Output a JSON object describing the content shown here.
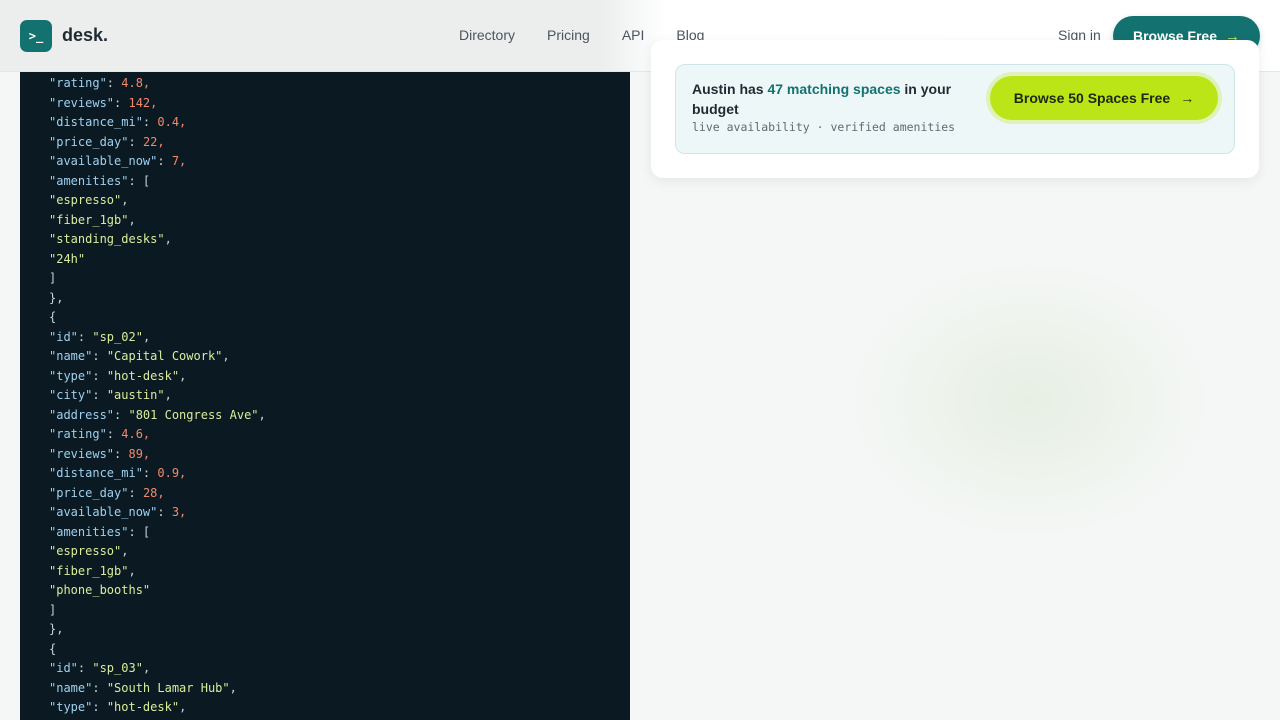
{
  "nav": {
    "logo_glyph": ">_",
    "brand": "desk.",
    "links": [
      "Directory",
      "Pricing",
      "API",
      "Blog"
    ],
    "signin": "Sign in",
    "cta": "Browse Free",
    "cta_arrow": "→"
  },
  "card": {
    "headline_pre": "Austin has ",
    "headline_highlight": "47 matching spaces",
    "headline_post": " in your budget",
    "subline": "live availability · verified amenities",
    "button": "Browse 50 Spaces Free",
    "button_arrow": "→"
  },
  "code": {
    "lines": [
      [
        [
          "key",
          "\"rating\""
        ],
        [
          "punc",
          ": "
        ],
        [
          "num",
          "4.8,"
        ]
      ],
      [
        [
          "key",
          "\"reviews\""
        ],
        [
          "punc",
          ": "
        ],
        [
          "num",
          "142,"
        ]
      ],
      [
        [
          "key",
          "\"distance_mi\""
        ],
        [
          "punc",
          ": "
        ],
        [
          "num",
          "0.4,"
        ]
      ],
      [
        [
          "key",
          "\"price_day\""
        ],
        [
          "punc",
          ": "
        ],
        [
          "num",
          "22,"
        ]
      ],
      [
        [
          "key",
          "\"available_now\""
        ],
        [
          "punc",
          ": "
        ],
        [
          "num",
          "7,"
        ]
      ],
      [
        [
          "key",
          "\"amenities\""
        ],
        [
          "punc",
          ": ["
        ]
      ],
      [
        [
          "str",
          "\"espresso\""
        ],
        [
          "punc",
          ","
        ]
      ],
      [
        [
          "str",
          "\"fiber_1gb\""
        ],
        [
          "punc",
          ","
        ]
      ],
      [
        [
          "str",
          "\"standing_desks\""
        ],
        [
          "punc",
          ","
        ]
      ],
      [
        [
          "str",
          "\"24h\""
        ]
      ],
      [
        [
          "punc",
          "]"
        ]
      ],
      [
        [
          "punc",
          "},"
        ]
      ],
      [
        [
          "punc",
          "{"
        ]
      ],
      [
        [
          "key",
          "\"id\""
        ],
        [
          "punc",
          ": "
        ],
        [
          "str",
          "\"sp_02\""
        ],
        [
          "punc",
          ","
        ]
      ],
      [
        [
          "key",
          "\"name\""
        ],
        [
          "punc",
          ": "
        ],
        [
          "str",
          "\"Capital Cowork\""
        ],
        [
          "punc",
          ","
        ]
      ],
      [
        [
          "key",
          "\"type\""
        ],
        [
          "punc",
          ": "
        ],
        [
          "str",
          "\"hot-desk\""
        ],
        [
          "punc",
          ","
        ]
      ],
      [
        [
          "key",
          "\"city\""
        ],
        [
          "punc",
          ": "
        ],
        [
          "str",
          "\"austin\""
        ],
        [
          "punc",
          ","
        ]
      ],
      [
        [
          "key",
          "\"address\""
        ],
        [
          "punc",
          ": "
        ],
        [
          "str",
          "\"801 Congress Ave\""
        ],
        [
          "punc",
          ","
        ]
      ],
      [
        [
          "key",
          "\"rating\""
        ],
        [
          "punc",
          ": "
        ],
        [
          "num",
          "4.6,"
        ]
      ],
      [
        [
          "key",
          "\"reviews\""
        ],
        [
          "punc",
          ": "
        ],
        [
          "num",
          "89,"
        ]
      ],
      [
        [
          "key",
          "\"distance_mi\""
        ],
        [
          "punc",
          ": "
        ],
        [
          "num",
          "0.9,"
        ]
      ],
      [
        [
          "key",
          "\"price_day\""
        ],
        [
          "punc",
          ": "
        ],
        [
          "num",
          "28,"
        ]
      ],
      [
        [
          "key",
          "\"available_now\""
        ],
        [
          "punc",
          ": "
        ],
        [
          "num",
          "3,"
        ]
      ],
      [
        [
          "key",
          "\"amenities\""
        ],
        [
          "punc",
          ": ["
        ]
      ],
      [
        [
          "str",
          "\"espresso\""
        ],
        [
          "punc",
          ","
        ]
      ],
      [
        [
          "str",
          "\"fiber_1gb\""
        ],
        [
          "punc",
          ","
        ]
      ],
      [
        [
          "str",
          "\"phone_booths\""
        ]
      ],
      [
        [
          "punc",
          "]"
        ]
      ],
      [
        [
          "punc",
          "},"
        ]
      ],
      [
        [
          "punc",
          "{"
        ]
      ],
      [
        [
          "key",
          "\"id\""
        ],
        [
          "punc",
          ": "
        ],
        [
          "str",
          "\"sp_03\""
        ],
        [
          "punc",
          ","
        ]
      ],
      [
        [
          "key",
          "\"name\""
        ],
        [
          "punc",
          ": "
        ],
        [
          "str",
          "\"South Lamar Hub\""
        ],
        [
          "punc",
          ","
        ]
      ],
      [
        [
          "key",
          "\"type\""
        ],
        [
          "punc",
          ": "
        ],
        [
          "str",
          "\"hot-desk\""
        ],
        [
          "punc",
          ","
        ]
      ]
    ]
  },
  "colors": {
    "brand_teal": "#13726f",
    "accent_lime": "#bbe517",
    "code_bg": "#0b1a22"
  }
}
